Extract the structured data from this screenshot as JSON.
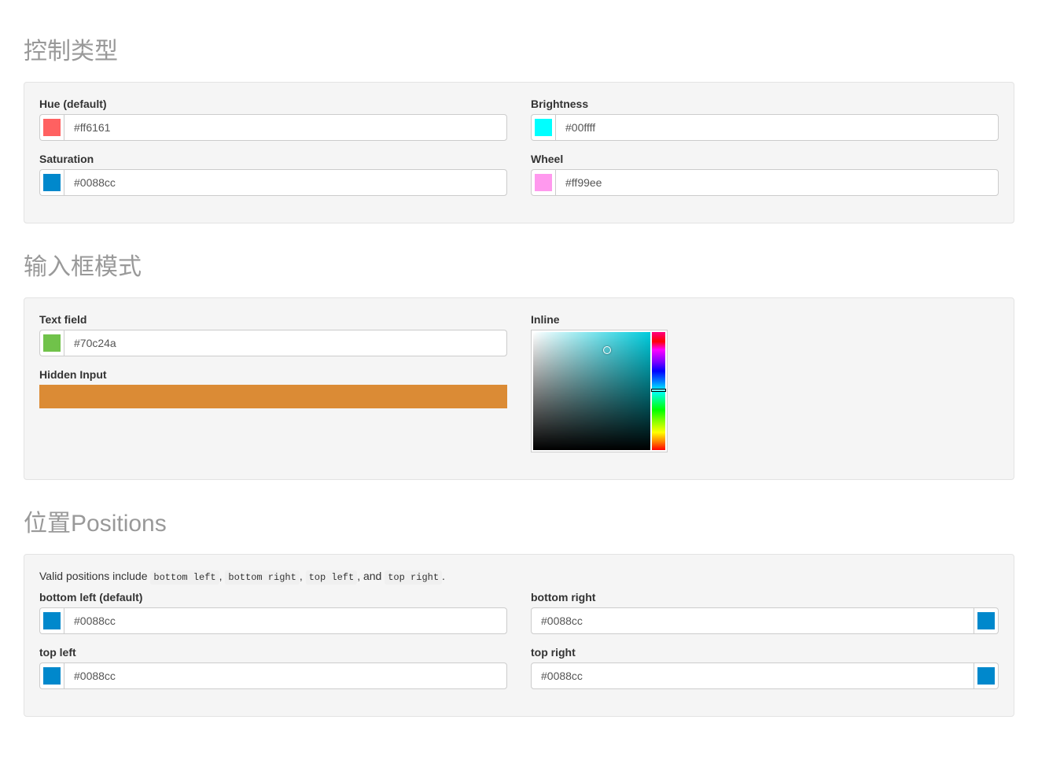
{
  "section1": {
    "heading": "控制类型",
    "fields": [
      {
        "label": "Hue (default)",
        "value": "#ff6161",
        "swatch": "#ff6161"
      },
      {
        "label": "Brightness",
        "value": "#00ffff",
        "swatch": "#00ffff"
      },
      {
        "label": "Saturation",
        "value": "#0088cc",
        "swatch": "#0088cc"
      },
      {
        "label": "Wheel",
        "value": "#ff99ee",
        "swatch": "#ff99ee"
      }
    ]
  },
  "section2": {
    "heading": "输入框模式",
    "textfield": {
      "label": "Text field",
      "value": "#70c24a",
      "swatch": "#70c24a"
    },
    "hidden": {
      "label": "Hidden Input",
      "color": "#db8b35"
    },
    "inline": {
      "label": "Inline",
      "cursor_left": "63%",
      "cursor_top": "15%",
      "slider_top": "48%"
    }
  },
  "section3": {
    "heading": "位置Positions",
    "help_prefix": "Valid positions include ",
    "help_codes": [
      "bottom left",
      "bottom right",
      "top left",
      "top right"
    ],
    "help_sep": ", ",
    "help_and": ", and ",
    "help_suffix": ".",
    "fields": [
      {
        "label": "bottom left (default)",
        "value": "#0088cc",
        "swatch": "#0088cc",
        "side": "left"
      },
      {
        "label": "bottom right",
        "value": "#0088cc",
        "swatch": "#0088cc",
        "side": "right"
      },
      {
        "label": "top left",
        "value": "#0088cc",
        "swatch": "#0088cc",
        "side": "left"
      },
      {
        "label": "top right",
        "value": "#0088cc",
        "swatch": "#0088cc",
        "side": "right"
      }
    ]
  }
}
